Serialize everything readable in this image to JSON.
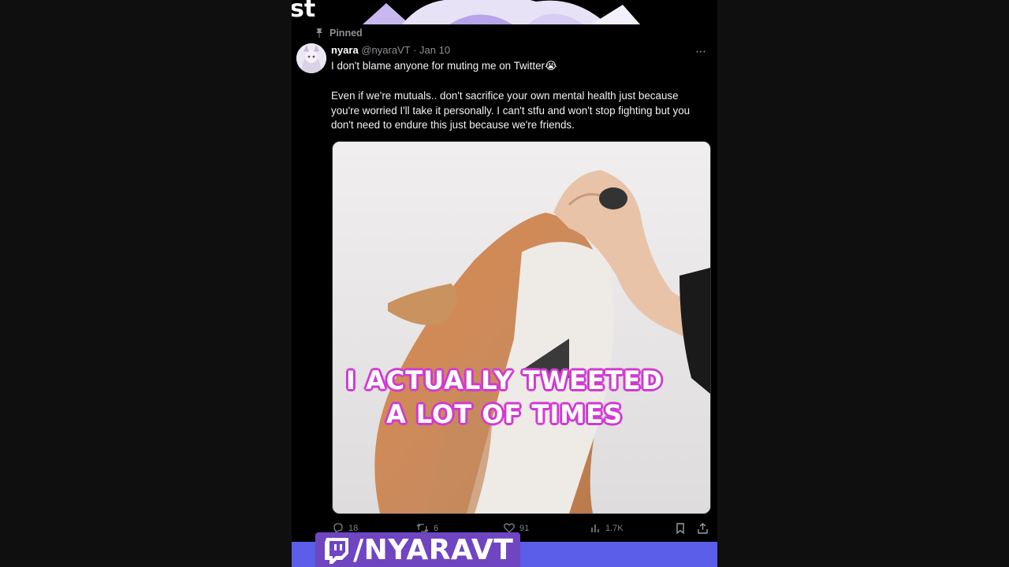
{
  "overlay": {
    "top_partial_text": "st"
  },
  "tweet": {
    "pinned_label": "Pinned",
    "author_name": "nyara",
    "author_handle": "@nyaraVT",
    "separator": "·",
    "date": "Jan 10",
    "text_line1": "I don't blame anyone for muting me on Twitter😭",
    "text_paragraph": "Even if we're mutuals.. don't sacrifice your own mental health just because you're worried I'll take it personally. I can't stfu and won't stop fighting but you don't need to endure this just because we're friends.",
    "more_icon": "⋯",
    "media_alt": "fox being scratched under chin"
  },
  "caption": {
    "line1": "I ACTUALLY TWEETED",
    "line2": "A LOT OF TIMES"
  },
  "actions": {
    "replies": "18",
    "reposts": "6",
    "likes": "91",
    "views": "1.7K"
  },
  "banner": {
    "text": "/NYARAVT",
    "icon": "twitch-icon"
  },
  "colors": {
    "caption_outline": "#d13ad1",
    "banner_bg": "#5b5ee8",
    "banner_accent": "#6f45c2"
  }
}
